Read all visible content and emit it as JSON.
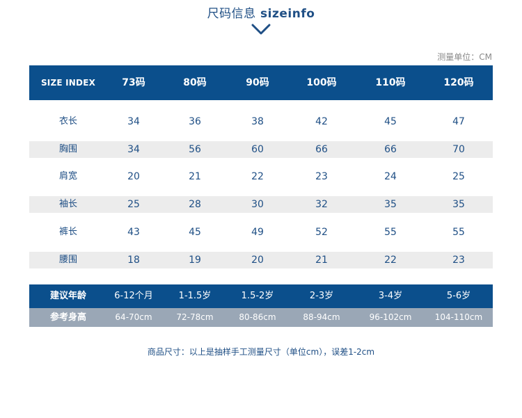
{
  "title": {
    "zh": "尺码信息",
    "en": "sizeinfo"
  },
  "unit_note": "测量单位：CM",
  "header": {
    "label": "SIZE INDEX",
    "sizes": [
      "73码",
      "80码",
      "90码",
      "100码",
      "110码",
      "120码"
    ]
  },
  "rows": [
    {
      "label": "衣长",
      "values": [
        "34",
        "36",
        "38",
        "42",
        "45",
        "47"
      ]
    },
    {
      "label": "胸围",
      "values": [
        "34",
        "56",
        "60",
        "66",
        "66",
        "70"
      ]
    },
    {
      "label": "肩宽",
      "values": [
        "20",
        "21",
        "22",
        "23",
        "24",
        "25"
      ]
    },
    {
      "label": "袖长",
      "values": [
        "25",
        "28",
        "30",
        "32",
        "35",
        "35"
      ]
    },
    {
      "label": "裤长",
      "values": [
        "43",
        "45",
        "49",
        "52",
        "55",
        "55"
      ]
    },
    {
      "label": "腰围",
      "values": [
        "18",
        "19",
        "20",
        "21",
        "22",
        "23"
      ]
    }
  ],
  "age": {
    "label": "建议年龄",
    "values": [
      "6-12个月",
      "1-1.5岁",
      "1.5-2岁",
      "2-3岁",
      "3-4岁",
      "5-6岁"
    ]
  },
  "height": {
    "label": "参考身高",
    "values": [
      "64-70cm",
      "72-78cm",
      "80-86cm",
      "88-94cm",
      "96-102cm",
      "104-110cm"
    ]
  },
  "footnote": "商品尺寸：以上是抽样手工测量尺寸（单位cm），误差1-2cm",
  "colors": {
    "brand_blue": "#0b4f8c",
    "row_shade": "#ececec",
    "height_band": "#9aa7b6",
    "text_blue": "#1f4f85"
  }
}
